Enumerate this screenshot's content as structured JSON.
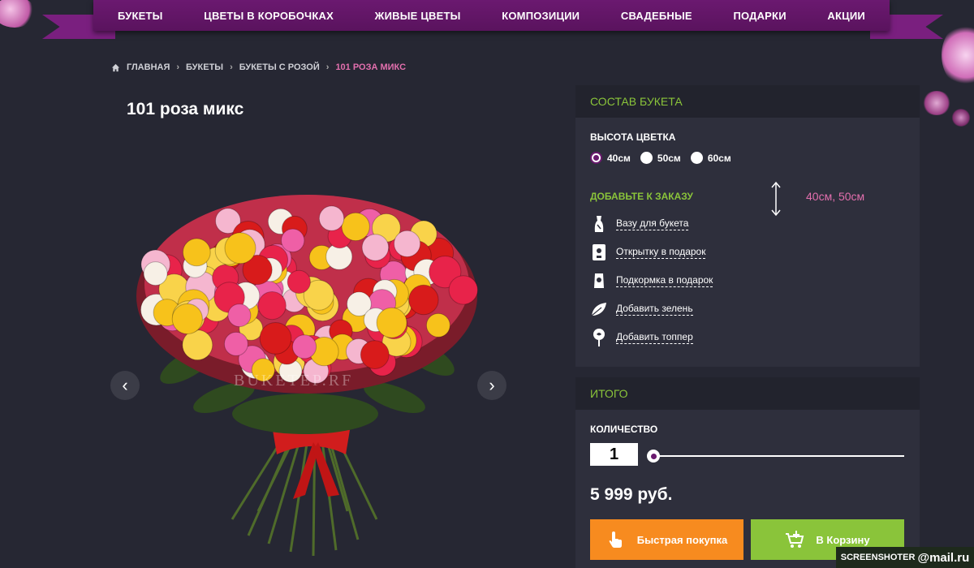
{
  "nav": {
    "items": [
      "БУКЕТЫ",
      "ЦВЕТЫ В КОРОБОЧКАХ",
      "ЖИВЫЕ ЦВЕТЫ",
      "КОМПОЗИЦИИ",
      "СВАДЕБНЫЕ",
      "ПОДАРКИ",
      "АКЦИИ"
    ]
  },
  "breadcrumb": {
    "items": [
      "ГЛАВНАЯ",
      "БУКЕТЫ",
      "БУКЕТЫ С РОЗОЙ"
    ],
    "current": "101 РОЗА МИКС"
  },
  "product": {
    "title": "101 роза микс",
    "watermark": "BUKETEP.RF"
  },
  "composition": {
    "header": "СОСТАВ БУКЕТА",
    "height_label": "ВЫСОТА ЦВЕТКА",
    "heights": [
      {
        "label": "40см",
        "checked": true
      },
      {
        "label": "50см",
        "checked": false
      },
      {
        "label": "60см",
        "checked": false
      }
    ],
    "add_title": "ДОБАВЬТЕ К ЗАКАЗУ",
    "height_note": "40см, 50см",
    "addons": [
      {
        "label": "Вазу для букета",
        "icon": "vase-icon"
      },
      {
        "label": "Открытку в подарок",
        "icon": "card-icon"
      },
      {
        "label": "Подкормка в подарок",
        "icon": "fertilizer-icon"
      },
      {
        "label": "Добавить зелень",
        "icon": "leaf-icon"
      },
      {
        "label": "Добавить топпер",
        "icon": "topper-icon"
      }
    ]
  },
  "total": {
    "header": "ИТОГО",
    "quantity_label": "КОЛИЧЕСТВО",
    "quantity": "1",
    "price": "5 999 руб.",
    "fast_buy": "Быстрая покупка",
    "to_cart": "В Корзину"
  },
  "overlay": {
    "brand": "SCREENSHOTER",
    "mail": "@mail.ru"
  },
  "colors": {
    "background": "#262733",
    "nav": "#6b1970",
    "accent_green": "#8ac43a",
    "accent_pink": "#e36fae",
    "fast_buy": "#f78b1f"
  }
}
